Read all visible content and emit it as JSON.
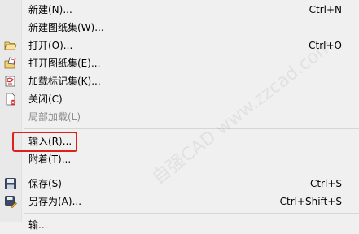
{
  "menu": {
    "items": [
      {
        "label": "新建(N)...",
        "shortcut": "Ctrl+N",
        "icon": "",
        "disabled": false
      },
      {
        "label": "新建图纸集(W)...",
        "shortcut": "",
        "icon": "",
        "disabled": false
      },
      {
        "label": "打开(O)...",
        "shortcut": "Ctrl+O",
        "icon": "open-folder-icon",
        "disabled": false
      },
      {
        "label": "打开图纸集(E)...",
        "shortcut": "",
        "icon": "open-sheetset-icon",
        "disabled": false
      },
      {
        "label": "加载标记集(K)...",
        "shortcut": "",
        "icon": "markup-set-icon",
        "disabled": false
      },
      {
        "label": "关闭(C)",
        "shortcut": "",
        "icon": "close-document-icon",
        "disabled": false
      },
      {
        "label": "局部加载(L)",
        "shortcut": "",
        "icon": "",
        "disabled": true
      },
      {
        "label": "输入(R)...",
        "shortcut": "",
        "icon": "",
        "disabled": false
      },
      {
        "label": "附着(T)...",
        "shortcut": "",
        "icon": "",
        "disabled": false
      },
      {
        "label": "保存(S)",
        "shortcut": "Ctrl+S",
        "icon": "save-disk-icon",
        "disabled": false
      },
      {
        "label": "另存为(A)...",
        "shortcut": "Ctrl+Shift+S",
        "icon": "save-as-icon",
        "disabled": false
      }
    ],
    "partial_next_label": "输..."
  },
  "watermark": {
    "text": "自强CAD www.zzcad.com"
  },
  "colors": {
    "highlight_border": "#e0201b",
    "menu_bg": "#f0f0f0",
    "disabled_text": "#8d8d8d"
  }
}
